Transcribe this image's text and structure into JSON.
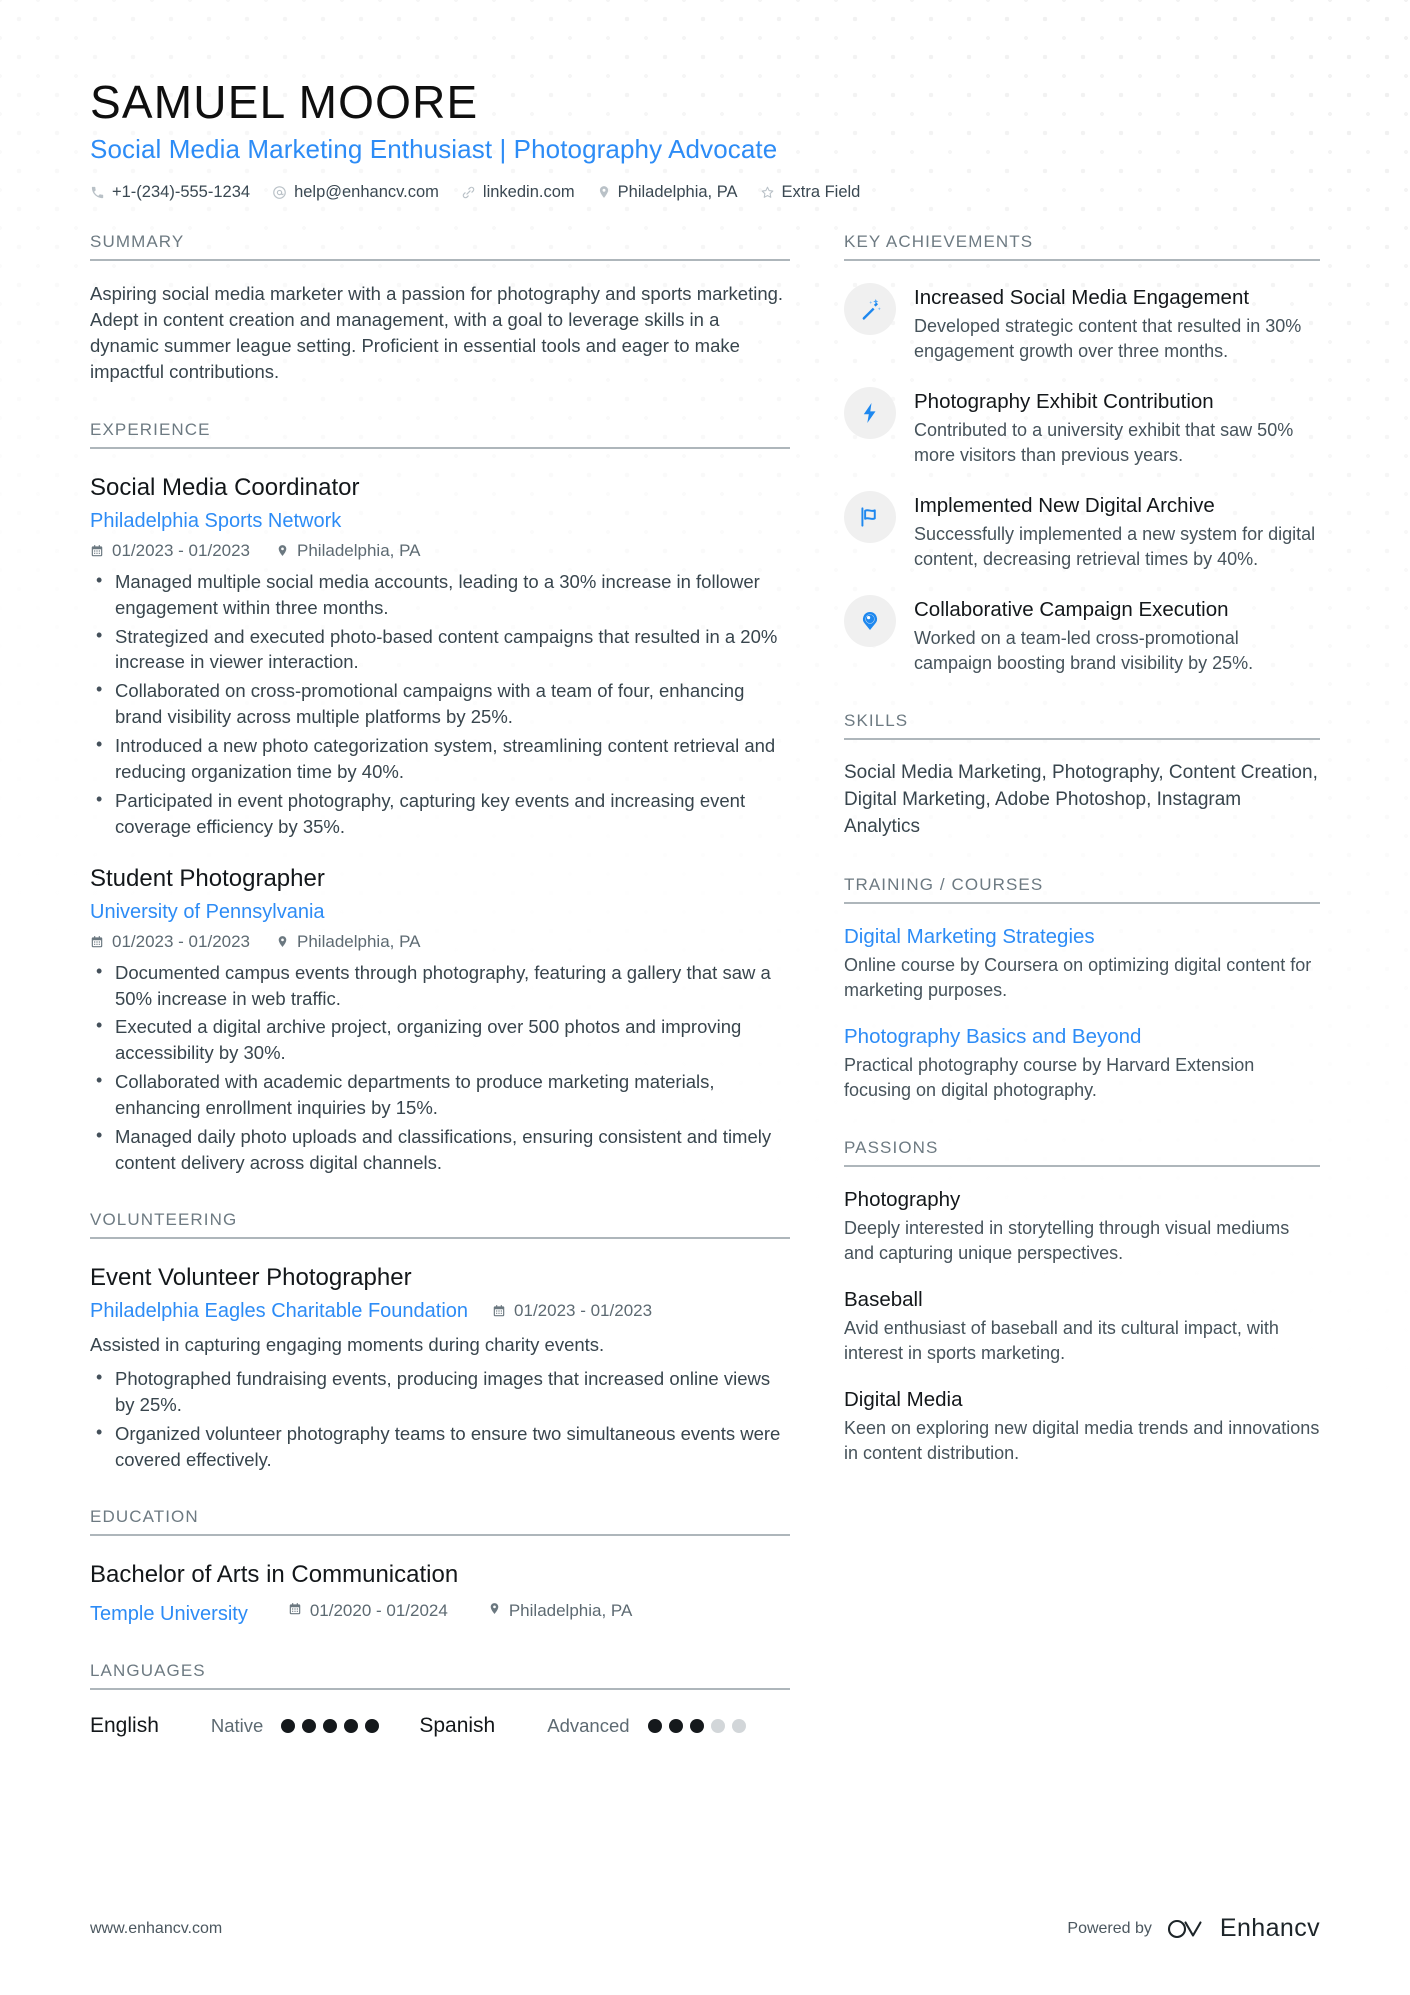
{
  "header": {
    "name": "SAMUEL MOORE",
    "headline": "Social Media Marketing Enthusiast | Photography Advocate",
    "contacts": [
      {
        "icon": "phone-icon",
        "text": "+1-(234)-555-1234"
      },
      {
        "icon": "email-icon",
        "text": "help@enhancv.com"
      },
      {
        "icon": "link-icon",
        "text": "linkedin.com"
      },
      {
        "icon": "location-pin-icon",
        "text": "Philadelphia, PA"
      },
      {
        "icon": "star-icon",
        "text": "Extra Field"
      }
    ]
  },
  "summary": {
    "title": "SUMMARY",
    "text": "Aspiring social media marketer with a passion for photography and sports marketing. Adept in content creation and management, with a goal to leverage skills in a dynamic summer league setting. Proficient in essential tools and eager to make impactful contributions."
  },
  "experience": {
    "title": "EXPERIENCE",
    "entries": [
      {
        "role": "Social Media Coordinator",
        "org": "Philadelphia Sports Network",
        "dates": "01/2023 - 01/2023",
        "location": "Philadelphia, PA",
        "bullets": [
          "Managed multiple social media accounts, leading to a 30% increase in follower engagement within three months.",
          "Strategized and executed photo-based content campaigns that resulted in a 20% increase in viewer interaction.",
          "Collaborated on cross-promotional campaigns with a team of four, enhancing brand visibility across multiple platforms by 25%.",
          "Introduced a new photo categorization system, streamlining content retrieval and reducing organization time by 40%.",
          "Participated in event photography, capturing key events and increasing event coverage efficiency by 35%."
        ]
      },
      {
        "role": "Student Photographer",
        "org": "University of Pennsylvania",
        "dates": "01/2023 - 01/2023",
        "location": "Philadelphia, PA",
        "bullets": [
          "Documented campus events through photography, featuring a gallery that saw a 50% increase in web traffic.",
          "Executed a digital archive project, organizing over 500 photos and improving accessibility by 30%.",
          "Collaborated with academic departments to produce marketing materials, enhancing enrollment inquiries by 15%.",
          "Managed daily photo uploads and classifications, ensuring consistent and timely content delivery across digital channels."
        ]
      }
    ]
  },
  "volunteering": {
    "title": "VOLUNTEERING",
    "entry": {
      "role": "Event Volunteer Photographer",
      "org": "Philadelphia Eagles Charitable Foundation",
      "dates": "01/2023 - 01/2023",
      "description": "Assisted in capturing engaging moments during charity events.",
      "bullets": [
        "Photographed fundraising events, producing images that increased online views by 25%.",
        "Organized volunteer photography teams to ensure two simultaneous events were covered effectively."
      ]
    }
  },
  "education": {
    "title": "EDUCATION",
    "entry": {
      "degree": "Bachelor of Arts in Communication",
      "school": "Temple University",
      "dates": "01/2020 - 01/2024",
      "location": "Philadelphia, PA"
    }
  },
  "languages": {
    "title": "LANGUAGES",
    "items": [
      {
        "name": "English",
        "level": "Native",
        "filled": 5,
        "total": 5
      },
      {
        "name": "Spanish",
        "level": "Advanced",
        "filled": 3,
        "total": 5
      }
    ]
  },
  "key_achievements": {
    "title": "KEY ACHIEVEMENTS",
    "items": [
      {
        "icon": "magic-wand-icon",
        "title": "Increased Social Media Engagement",
        "description": "Developed strategic content that resulted in 30% engagement growth over three months."
      },
      {
        "icon": "lightning-bolt-icon",
        "title": "Photography Exhibit Contribution",
        "description": "Contributed to a university exhibit that saw 50% more visitors than previous years."
      },
      {
        "icon": "flag-icon",
        "title": "Implemented New Digital Archive",
        "description": "Successfully implemented a new system for digital content, decreasing retrieval times by 40%."
      },
      {
        "icon": "speech-pin-icon",
        "title": "Collaborative Campaign Execution",
        "description": "Worked on a team-led cross-promotional campaign boosting brand visibility by 25%."
      }
    ]
  },
  "skills": {
    "title": "SKILLS",
    "text": "Social Media Marketing, Photography, Content Creation, Digital Marketing, Adobe Photoshop, Instagram Analytics"
  },
  "training": {
    "title": "TRAINING / COURSES",
    "items": [
      {
        "name": "Digital Marketing Strategies",
        "description": "Online course by Coursera on optimizing digital content for marketing purposes."
      },
      {
        "name": "Photography Basics and Beyond",
        "description": "Practical photography course by Harvard Extension focusing on digital photography."
      }
    ]
  },
  "passions": {
    "title": "PASSIONS",
    "items": [
      {
        "name": "Photography",
        "description": "Deeply interested in storytelling through visual mediums and capturing unique perspectives."
      },
      {
        "name": "Baseball",
        "description": "Avid enthusiast of baseball and its cultural impact, with interest in sports marketing."
      },
      {
        "name": "Digital Media",
        "description": "Keen on exploring new digital media trends and innovations in content distribution."
      }
    ]
  },
  "footer": {
    "url": "www.enhancv.com",
    "powered_by": "Powered by",
    "brand": "Enhancv"
  },
  "colors": {
    "accent": "#2d8cf6",
    "heading": "#6d7a82",
    "text": "#38454d"
  }
}
